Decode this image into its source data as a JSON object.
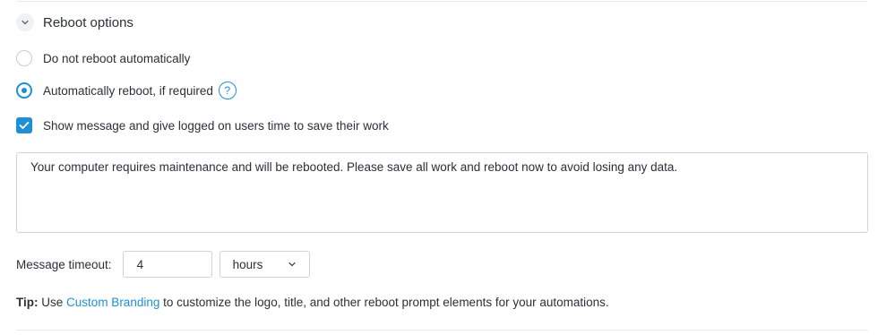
{
  "section": {
    "title": "Reboot options"
  },
  "options": {
    "no_reboot": {
      "label": "Do not reboot automatically",
      "selected": false
    },
    "auto_reboot": {
      "label": "Automatically reboot, if required",
      "selected": true,
      "help": "?"
    },
    "show_message": {
      "label": "Show message and give logged on users time to save their work",
      "checked": true
    }
  },
  "message": {
    "text": "Your computer requires maintenance and will be rebooted. Please save all work and reboot now to avoid losing any data."
  },
  "timeout": {
    "label": "Message timeout:",
    "value": "4",
    "unit": "hours"
  },
  "tip": {
    "prefix": "Tip:",
    "use": "Use",
    "link": "Custom Branding",
    "suffix": "to customize the logo, title, and other reboot prompt elements for your automations."
  },
  "colors": {
    "accent": "#1f8fd6",
    "text": "#2b2f38",
    "border": "#cfd3da"
  }
}
